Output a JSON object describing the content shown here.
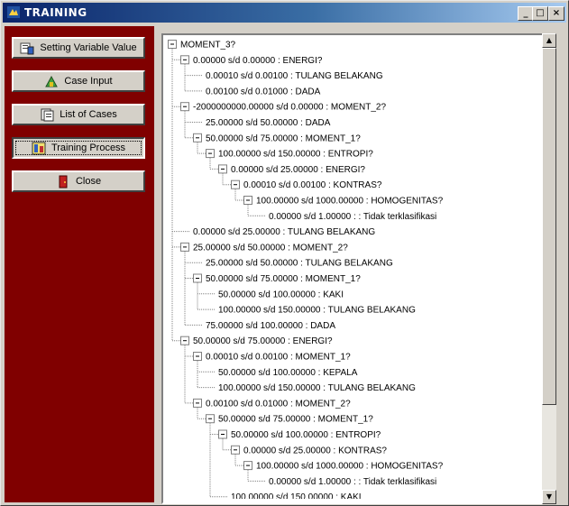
{
  "window": {
    "title": "TRAINING",
    "minimize_glyph": "_",
    "maximize_glyph": "□",
    "close_glyph": "×"
  },
  "sidebar": {
    "buttons": [
      {
        "label": "Setting Variable Value",
        "icon": "settings-icon"
      },
      {
        "label": "Case Input",
        "icon": "case-input-icon"
      },
      {
        "label": "List of Cases",
        "icon": "list-icon"
      },
      {
        "label": "Training Process",
        "icon": "training-icon",
        "pressed": true
      },
      {
        "label": "Close",
        "icon": "close-door-icon"
      }
    ]
  },
  "tree": {
    "nodes": [
      {
        "level": 0,
        "text": "MOMENT_3?",
        "expandable": true
      },
      {
        "level": 1,
        "text": "0.00000 s/d 0.00000 : ENERGI?",
        "expandable": true
      },
      {
        "level": 2,
        "text": "0.00010 s/d 0.00100 : TULANG BELAKANG",
        "expandable": false
      },
      {
        "level": 2,
        "text": "0.00100 s/d 0.01000 : DADA",
        "expandable": false
      },
      {
        "level": 1,
        "text": "-2000000000.00000 s/d 0.00000 : MOMENT_2?",
        "expandable": true
      },
      {
        "level": 2,
        "text": "25.00000 s/d 50.00000 : DADA",
        "expandable": false
      },
      {
        "level": 2,
        "text": "50.00000 s/d 75.00000 : MOMENT_1?",
        "expandable": true
      },
      {
        "level": 3,
        "text": "100.00000 s/d 150.00000 : ENTROPI?",
        "expandable": true
      },
      {
        "level": 4,
        "text": "0.00000 s/d 25.00000 : ENERGI?",
        "expandable": true
      },
      {
        "level": 5,
        "text": "0.00010 s/d 0.00100 : KONTRAS?",
        "expandable": true
      },
      {
        "level": 6,
        "text": "100.00000 s/d 1000.00000 : HOMOGENITAS?",
        "expandable": true
      },
      {
        "level": 7,
        "text": "0.00000 s/d 1.00000 : : Tidak terklasifikasi",
        "expandable": false
      },
      {
        "level": 1,
        "text": "0.00000 s/d 25.00000 : TULANG BELAKANG",
        "expandable": false
      },
      {
        "level": 1,
        "text": "25.00000 s/d 50.00000 : MOMENT_2?",
        "expandable": true
      },
      {
        "level": 2,
        "text": "25.00000 s/d 50.00000 : TULANG BELAKANG",
        "expandable": false
      },
      {
        "level": 2,
        "text": "50.00000 s/d 75.00000 : MOMENT_1?",
        "expandable": true
      },
      {
        "level": 3,
        "text": "50.00000 s/d 100.00000 : KAKI",
        "expandable": false
      },
      {
        "level": 3,
        "text": "100.00000 s/d 150.00000 : TULANG BELAKANG",
        "expandable": false
      },
      {
        "level": 2,
        "text": "75.00000 s/d 100.00000 : DADA",
        "expandable": false
      },
      {
        "level": 1,
        "text": "50.00000 s/d 75.00000 : ENERGI?",
        "expandable": true
      },
      {
        "level": 2,
        "text": "0.00010 s/d 0.00100 : MOMENT_1?",
        "expandable": true
      },
      {
        "level": 3,
        "text": "50.00000 s/d 100.00000 : KEPALA",
        "expandable": false
      },
      {
        "level": 3,
        "text": "100.00000 s/d 150.00000 : TULANG BELAKANG",
        "expandable": false
      },
      {
        "level": 2,
        "text": "0.00100 s/d 0.01000 : MOMENT_2?",
        "expandable": true
      },
      {
        "level": 3,
        "text": "50.00000 s/d 75.00000 : MOMENT_1?",
        "expandable": true
      },
      {
        "level": 4,
        "text": "50.00000 s/d 100.00000 : ENTROPI?",
        "expandable": true
      },
      {
        "level": 5,
        "text": "0.00000 s/d 25.00000 : KONTRAS?",
        "expandable": true
      },
      {
        "level": 6,
        "text": "100.00000 s/d 1000.00000 : HOMOGENITAS?",
        "expandable": true
      },
      {
        "level": 7,
        "text": "0.00000 s/d 1.00000 : : Tidak terklasifikasi",
        "expandable": false
      },
      {
        "level": 4,
        "text": "100.00000 s/d 150.00000 : KAKI",
        "expandable": false
      }
    ]
  },
  "scrollbar": {
    "up_glyph": "▲",
    "down_glyph": "▼"
  }
}
